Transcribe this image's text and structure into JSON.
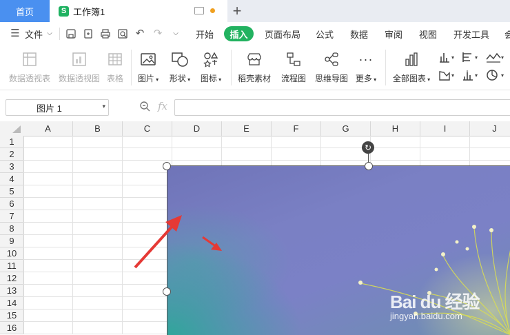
{
  "tabs": {
    "home": "首页",
    "document": "工作簿1",
    "doc_icon": "S",
    "add": "+"
  },
  "menu": {
    "file": "文件",
    "items": [
      "开始",
      "插入",
      "页面布局",
      "公式",
      "数据",
      "审阅",
      "视图",
      "开发工具",
      "会"
    ],
    "active": "插入"
  },
  "ribbon": {
    "pivot_table": "数据透视表",
    "pivot_chart": "数据透视图",
    "table": "表格",
    "picture": "图片",
    "shape": "形状",
    "icon": "图标",
    "docer": "稻壳素材",
    "flowchart": "流程图",
    "mindmap": "思维导图",
    "more": "更多",
    "all_charts": "全部图表"
  },
  "formula_bar": {
    "name_box": "图片 1",
    "fx": "fx"
  },
  "grid": {
    "columns": [
      "A",
      "B",
      "C",
      "D",
      "E",
      "F",
      "G",
      "H",
      "I",
      "J"
    ],
    "rows": [
      "1",
      "2",
      "3",
      "4",
      "5",
      "6",
      "7",
      "8",
      "9",
      "10",
      "11",
      "12",
      "13",
      "14",
      "15",
      "16"
    ]
  },
  "watermark": {
    "main": "Bai du 经验",
    "sub": "jingyan.baidu.com"
  },
  "colors": {
    "accent_green": "#22b260",
    "home_tab_blue": "#4a90f0",
    "arrow_red": "#e53935"
  }
}
